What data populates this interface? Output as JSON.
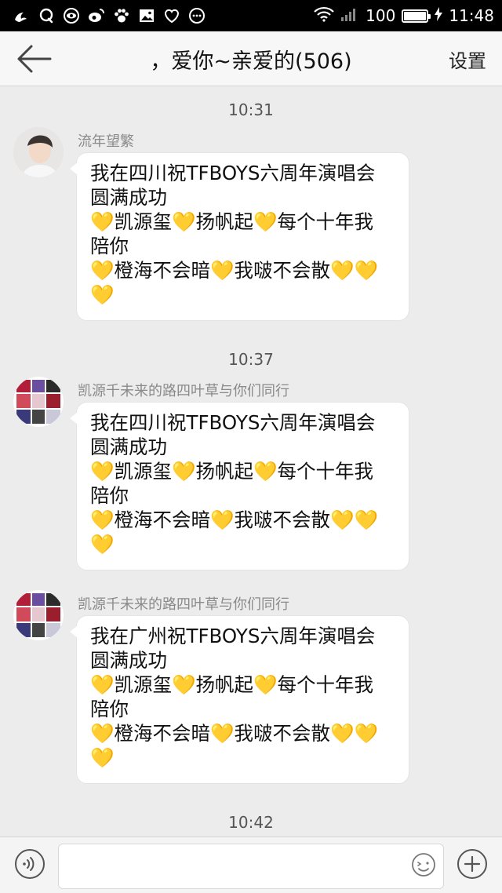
{
  "status_bar": {
    "icons_left": [
      "uc-browser-icon",
      "qq-icon",
      "eye-app-icon",
      "weibo-icon",
      "paw-icon",
      "image-icon",
      "heart-outline-icon",
      "more-dots-icon"
    ],
    "battery_level": "100",
    "battery_fraction": 1.0,
    "time": "11:48"
  },
  "header": {
    "title": "，爱你~亲爱的(506)",
    "settings_label": "设置"
  },
  "messages": [
    {
      "time": "10:31",
      "sender": "流年望繁",
      "lines": [
        "我在四川祝TFBOYS六周年演唱会",
        "圆满成功",
        "💛凯源玺💛扬帆起💛每个十年我",
        "陪你",
        "💛橙海不会暗💛我啵不会散💛💛",
        "💛"
      ]
    },
    {
      "time": "10:37",
      "sender": "凯源千未来的路四叶草与你们同行",
      "lines": [
        "我在四川祝TFBOYS六周年演唱会",
        "圆满成功",
        "💛凯源玺💛扬帆起💛每个十年我",
        "陪你",
        "💛橙海不会暗💛我啵不会散💛💛",
        "💛"
      ]
    },
    {
      "time": "",
      "sender": "凯源千未来的路四叶草与你们同行",
      "lines": [
        "我在广州祝TFBOYS六周年演唱会",
        "圆满成功",
        "💛凯源玺💛扬帆起💛每个十年我",
        "陪你",
        "💛橙海不会暗💛我啵不会散💛💛",
        "💛"
      ]
    }
  ],
  "last_time": "10:42",
  "input": {
    "value": "",
    "placeholder": ""
  },
  "colors": {
    "background": "#ececec",
    "bubble": "#ffffff",
    "heart": "#f5b800"
  }
}
